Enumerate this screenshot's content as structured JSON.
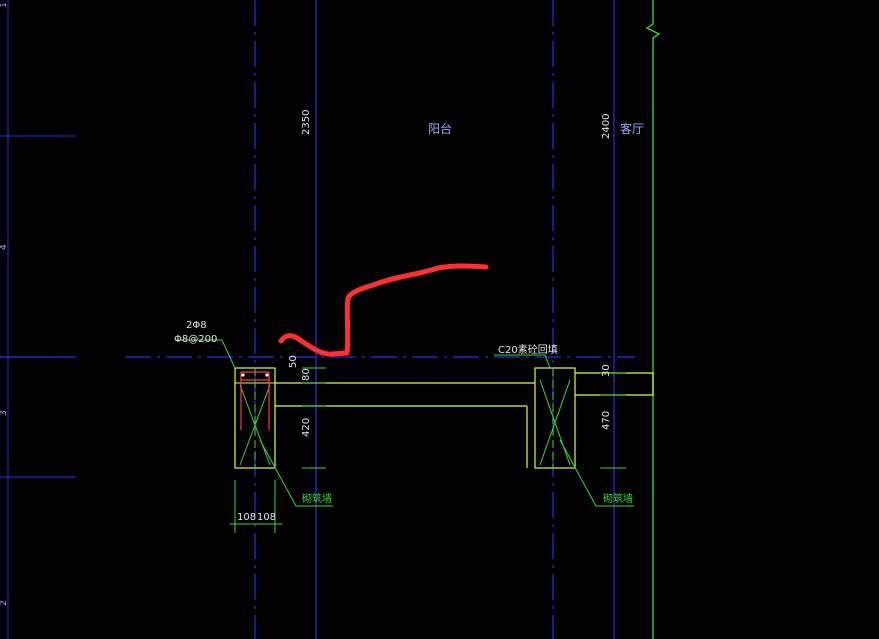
{
  "drawing": {
    "room_labels": {
      "balcony": "阳台",
      "living_room": "客厅"
    },
    "dimensions": {
      "span_left": "2350",
      "span_right": "2400",
      "left_50": "50",
      "left_80": "80",
      "left_420": "420",
      "right_30": "30",
      "right_470": "470",
      "bottom_108_a": "108",
      "bottom_108_b": "108"
    },
    "annotations": {
      "rebar_top": "2Φ8",
      "rebar_stirrup": "Φ8@200",
      "concrete_note": "C20素砼回填",
      "left_leader_note": "砌筑墙",
      "right_leader_note": "砌筑墙"
    },
    "left_axis_ticks": [
      "1",
      "4",
      "3",
      "2"
    ],
    "colors": {
      "background": "#000000",
      "axis_line": "#2d2de6",
      "outline": "#d8ff3a",
      "green_line": "#3ad93a",
      "rebar": "#ff3b3b",
      "markup": "#ff3030",
      "text_blue": "#9aa8ff",
      "text_white": "#e6e6e6"
    }
  }
}
